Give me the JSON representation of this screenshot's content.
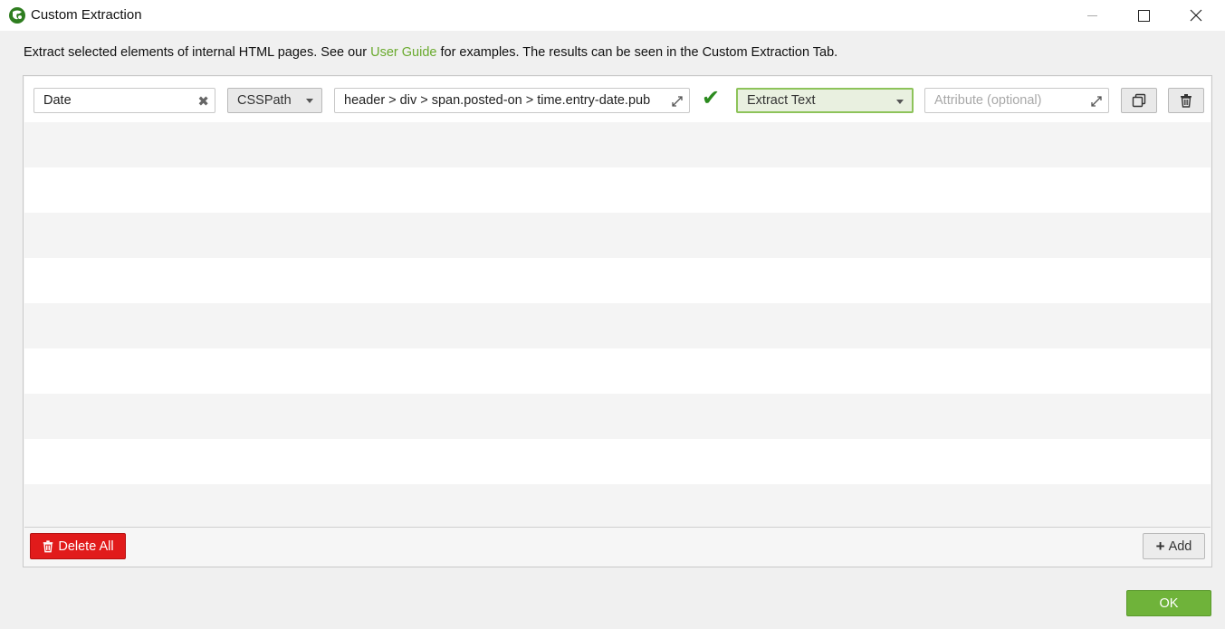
{
  "window": {
    "title": "Custom Extraction"
  },
  "intro": {
    "text_before": "Extract selected elements of internal HTML pages. See our ",
    "link_text": "User Guide",
    "text_after": " for examples. The results can be seen in the Custom Extraction Tab."
  },
  "extractor": {
    "name_value": "Date",
    "type_selected": "CSSPath",
    "path_value": "header > div > span.posted-on > time.entry-date.pub",
    "mode_selected": "Extract Text",
    "attribute_placeholder": "Attribute (optional)"
  },
  "footer": {
    "delete_all_label": "Delete All",
    "add_label": "Add"
  },
  "ok_label": "OK",
  "colors": {
    "accent_green": "#6fb33a",
    "link_green": "#6aaa2e",
    "valid_check": "#2b8a1e",
    "danger_red": "#e11b1b"
  },
  "icons": [
    "app-logo-icon",
    "clear-icon",
    "chevron-down-icon",
    "expand-icon",
    "checkmark-icon",
    "copy-icon",
    "trash-icon",
    "plus-icon"
  ]
}
